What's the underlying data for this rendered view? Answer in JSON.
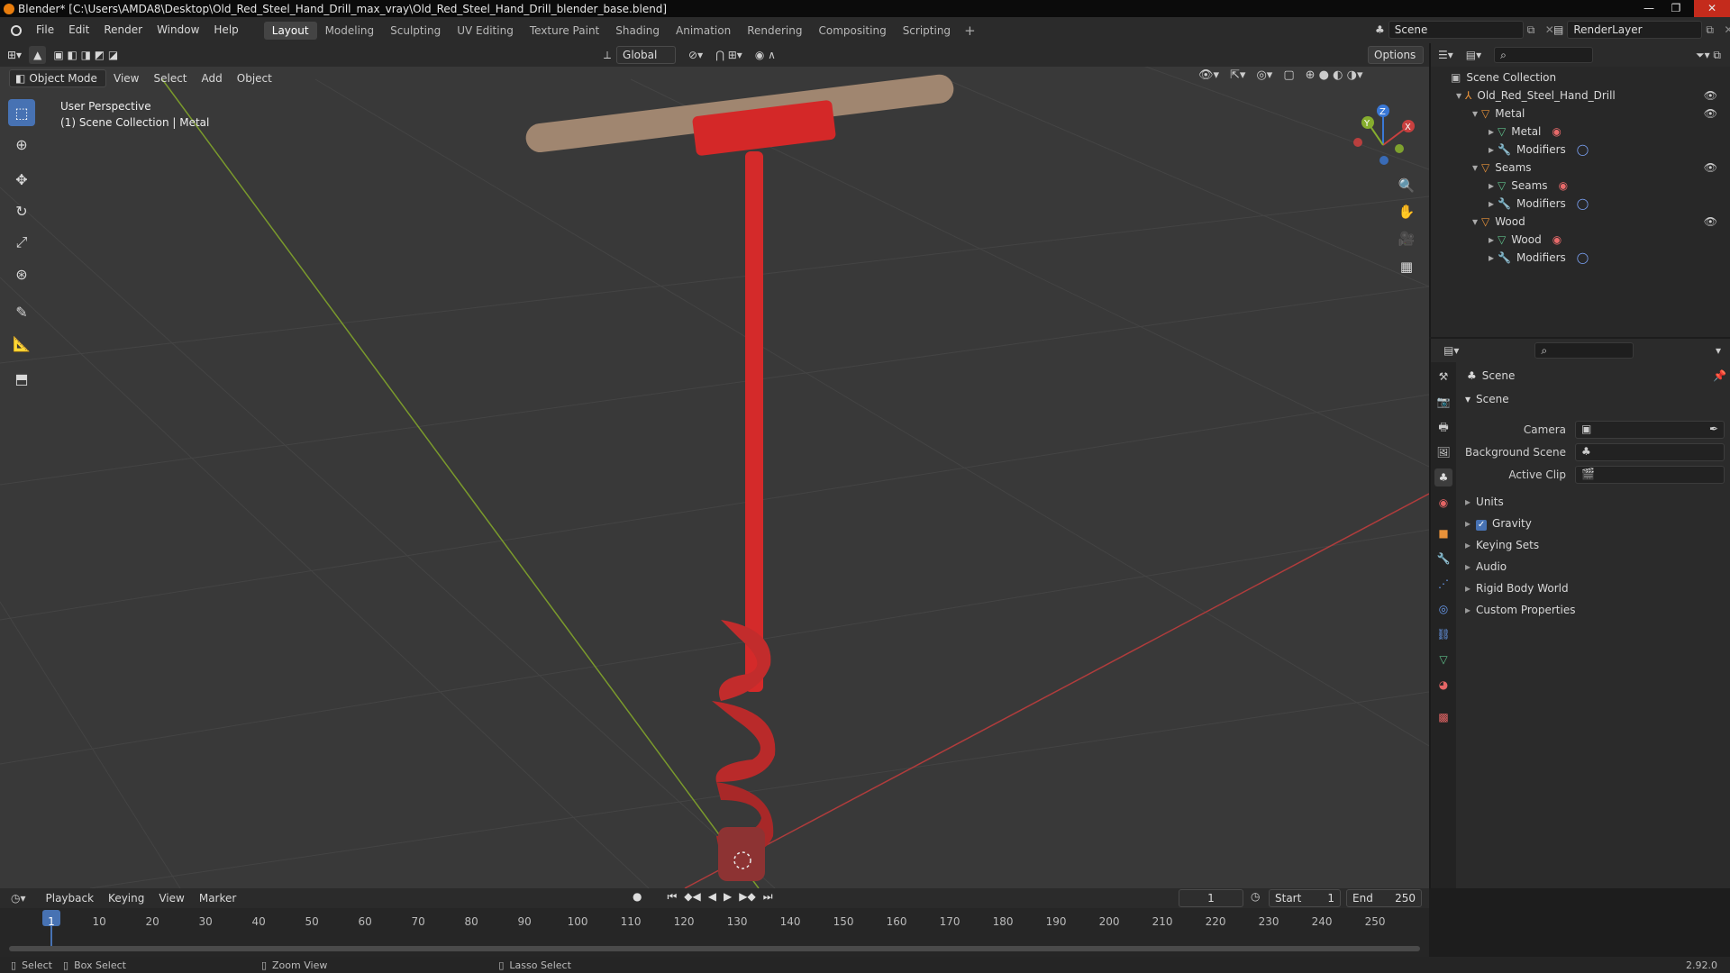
{
  "titlebar": {
    "title": "Blender* [C:\\Users\\AMDA8\\Desktop\\Old_Red_Steel_Hand_Drill_max_vray\\Old_Red_Steel_Hand_Drill_blender_base.blend]",
    "minimize": "—",
    "maximize": "❐",
    "close": "✕"
  },
  "menu": [
    "File",
    "Edit",
    "Render",
    "Window",
    "Help"
  ],
  "workspaces": [
    "Layout",
    "Modeling",
    "Sculpting",
    "UV Editing",
    "Texture Paint",
    "Shading",
    "Animation",
    "Rendering",
    "Compositing",
    "Scripting"
  ],
  "workspace_add": "+",
  "scene_field": "Scene",
  "renderlayer_field": "RenderLayer",
  "tool_header": {
    "transform_orientation": "Global",
    "options": "Options"
  },
  "viewport_header": {
    "mode": "Object Mode",
    "items": [
      "View",
      "Select",
      "Add",
      "Object"
    ]
  },
  "viewport": {
    "info_line1": "User Perspective",
    "info_line2": "(1) Scene Collection | Metal",
    "gizmo": {
      "x": "X",
      "y": "Y",
      "z": "Z"
    }
  },
  "outliner": {
    "root": "Scene Collection",
    "collection": "Old_Red_Steel_Hand_Drill",
    "objects": [
      {
        "name": "Metal",
        "mesh": "Metal",
        "modifiers": "Modifiers"
      },
      {
        "name": "Seams",
        "mesh": "Seams",
        "modifiers": "Modifiers"
      },
      {
        "name": "Wood",
        "mesh": "Wood",
        "modifiers": "Modifiers"
      }
    ]
  },
  "properties": {
    "context": "Scene",
    "panel": "Scene",
    "camera_label": "Camera",
    "background_label": "Background Scene",
    "clip_label": "Active Clip",
    "sections": [
      "Units",
      "Gravity",
      "Keying Sets",
      "Audio",
      "Rigid Body World",
      "Custom Properties"
    ],
    "gravity_checked": true
  },
  "timeline": {
    "menus": [
      "Playback",
      "Keying",
      "View",
      "Marker"
    ],
    "current_frame": "1",
    "start_label": "Start",
    "start": "1",
    "end_label": "End",
    "end": "250",
    "ticks": [
      "1",
      "10",
      "20",
      "30",
      "40",
      "50",
      "60",
      "70",
      "80",
      "90",
      "100",
      "110",
      "120",
      "130",
      "140",
      "150",
      "160",
      "170",
      "180",
      "190",
      "200",
      "210",
      "220",
      "230",
      "240",
      "250"
    ]
  },
  "status": {
    "select": "Select",
    "box_select": "Box Select",
    "zoom_view": "Zoom View",
    "lasso_select": "Lasso Select",
    "version": "2.92.0"
  },
  "colors": {
    "accent": "#4772b3",
    "x_axis": "#c8403f",
    "y_axis": "#86ad2e",
    "z_axis": "#3a78d6",
    "object_orange": "#e8923a",
    "mesh_green": "#5fbf8a"
  }
}
